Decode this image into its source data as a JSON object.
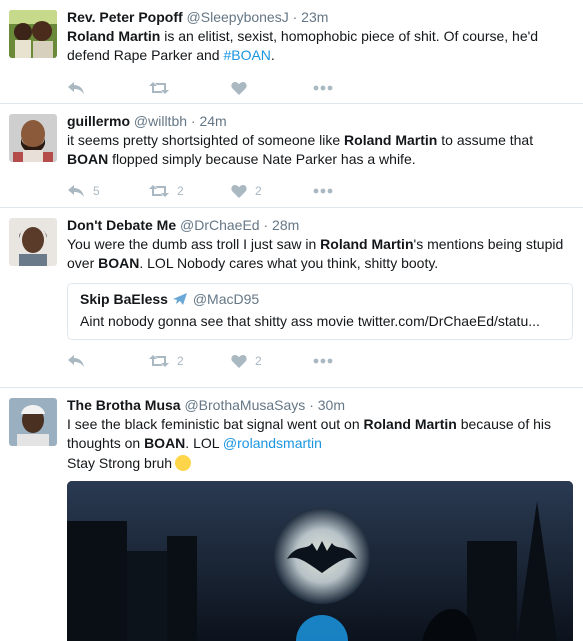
{
  "tweets": [
    {
      "name": "Rev. Peter Popoff",
      "handle": "@SleepybonesJ",
      "time": "23m",
      "segments": [
        {
          "t": "Roland Martin",
          "b": true
        },
        {
          "t": " is an elitist, sexist, homophobic piece of shit. Of course, he'd defend Rape Parker and "
        },
        {
          "t": "#BOAN",
          "hashtag": true
        },
        {
          "t": "."
        }
      ],
      "counts": {
        "reply": "",
        "retweet": "",
        "like": ""
      }
    },
    {
      "name": "guillermo",
      "handle": "@willtbh",
      "time": "24m",
      "segments": [
        {
          "t": "it seems pretty shortsighted of someone like "
        },
        {
          "t": "Roland Martin",
          "b": true
        },
        {
          "t": " to assume that "
        },
        {
          "t": "BOAN",
          "b": true
        },
        {
          "t": " flopped simply because Nate Parker has a whife."
        }
      ],
      "counts": {
        "reply": "5",
        "retweet": "2",
        "like": "2"
      }
    },
    {
      "name": "Don't Debate Me",
      "handle": "@DrChaeEd",
      "time": "28m",
      "segments": [
        {
          "t": "You were the dumb ass troll I just saw in "
        },
        {
          "t": "Roland Martin",
          "b": true
        },
        {
          "t": "'s mentions being stupid over "
        },
        {
          "t": "BOAN",
          "b": true
        },
        {
          "t": ". LOL Nobody cares what you think, shitty booty."
        }
      ],
      "quote": {
        "name": "Skip BaEless",
        "handle": "@MacD95",
        "text": "Aint nobody gonna see that shitty ass movie twitter.com/DrChaeEd/statu..."
      },
      "counts": {
        "reply": "",
        "retweet": "2",
        "like": "2"
      }
    },
    {
      "name": "The Brotha Musa",
      "handle": "@BrothaMusaSays",
      "time": "30m",
      "segments": [
        {
          "t": "I see the black feministic bat signal went out on "
        },
        {
          "t": "Roland Martin",
          "b": true
        },
        {
          "t": " because of his thoughts on "
        },
        {
          "t": "BOAN",
          "b": true
        },
        {
          "t": ". LOL "
        },
        {
          "t": "@rolandsmartin",
          "hashtag": true
        }
      ],
      "line2": "Stay Strong bruh",
      "emoji": "raised-fist-emoji"
    }
  ],
  "header_separator": "·",
  "icons": {
    "reply": "reply-icon",
    "retweet": "retweet-icon",
    "like": "heart-icon",
    "more": "more-icon"
  },
  "colors": {
    "link": "#1b95e0",
    "muted": "#657786",
    "action": "#aab8c2",
    "border": "#e1e8ed"
  }
}
